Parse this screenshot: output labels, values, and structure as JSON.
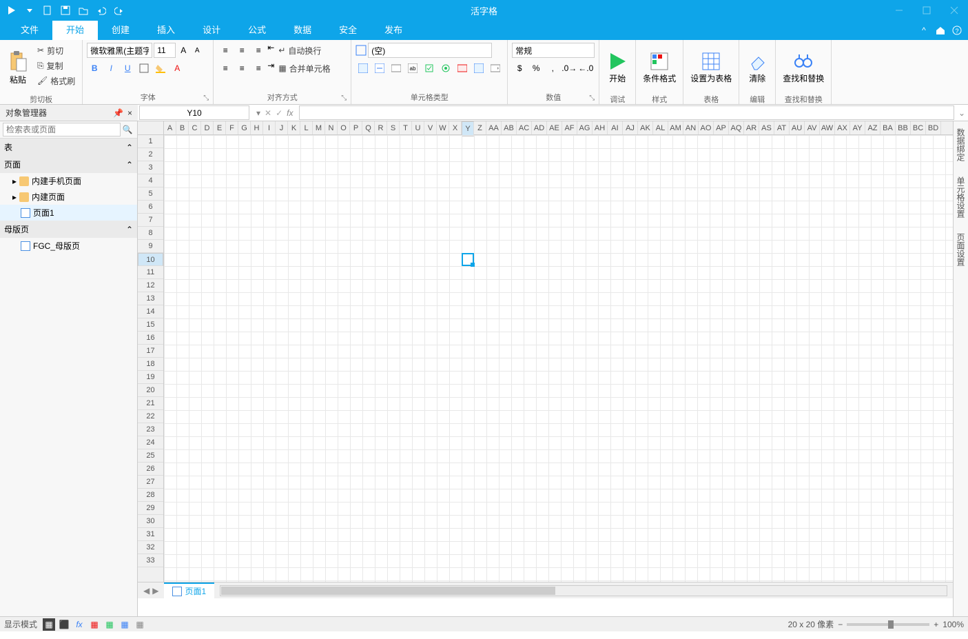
{
  "app_title": "活字格",
  "tabs": [
    "文件",
    "开始",
    "创建",
    "插入",
    "设计",
    "公式",
    "数据",
    "安全",
    "发布"
  ],
  "active_tab": 1,
  "ribbon": {
    "clipboard": {
      "paste": "粘贴",
      "cut": "剪切",
      "copy": "复制",
      "format_painter": "格式刷",
      "label": "剪切板"
    },
    "font": {
      "font_name": "微软雅黑(主题字体)",
      "font_size": "11",
      "label": "字体"
    },
    "alignment": {
      "wrap": "自动换行",
      "merge": "合并单元格",
      "label": "对齐方式"
    },
    "celltype": {
      "empty": "(空)",
      "label": "单元格类型"
    },
    "number": {
      "general": "常规",
      "label": "数值"
    },
    "start_debug": {
      "start": "开始",
      "debug": "调试"
    },
    "style": {
      "cond_format": "条件格式",
      "label": "样式"
    },
    "table": {
      "set_as_table": "设置为表格",
      "label": "表格"
    },
    "edit": {
      "clear": "清除",
      "label": "编辑"
    },
    "find": {
      "find_replace": "查找和替换",
      "label": "查找和替换"
    }
  },
  "object_manager": {
    "title": "对象管理器",
    "search_placeholder": "检索表或页面",
    "sections": {
      "tables": "表",
      "pages": "页面",
      "master": "母版页"
    },
    "page_items": [
      "内建手机页面",
      "内建页面",
      "页面1"
    ],
    "master_items": [
      "FGC_母版页"
    ]
  },
  "namebox": "Y10",
  "columns": [
    "A",
    "B",
    "C",
    "D",
    "E",
    "F",
    "G",
    "H",
    "I",
    "J",
    "K",
    "L",
    "M",
    "N",
    "O",
    "P",
    "Q",
    "R",
    "S",
    "T",
    "U",
    "V",
    "W",
    "X",
    "Y",
    "Z",
    "AA",
    "AB",
    "AC",
    "AD",
    "AE",
    "AF",
    "AG",
    "AH",
    "AI",
    "AJ",
    "AK",
    "AL",
    "AM",
    "AN",
    "AO",
    "AP",
    "AQ",
    "AR",
    "AS",
    "AT",
    "AU",
    "AV",
    "AW",
    "AX",
    "AY",
    "AZ",
    "BA",
    "BB",
    "BC",
    "BD"
  ],
  "selected_col": "Y",
  "rows_count": 33,
  "selected_row": 10,
  "sheet_tab": "页面1",
  "right_tabs": [
    "数据绑定",
    "单元格设置",
    "页面设置"
  ],
  "status": {
    "display_mode": "显示模式",
    "cell_size": "20 x 20 像素",
    "zoom": "100%"
  }
}
